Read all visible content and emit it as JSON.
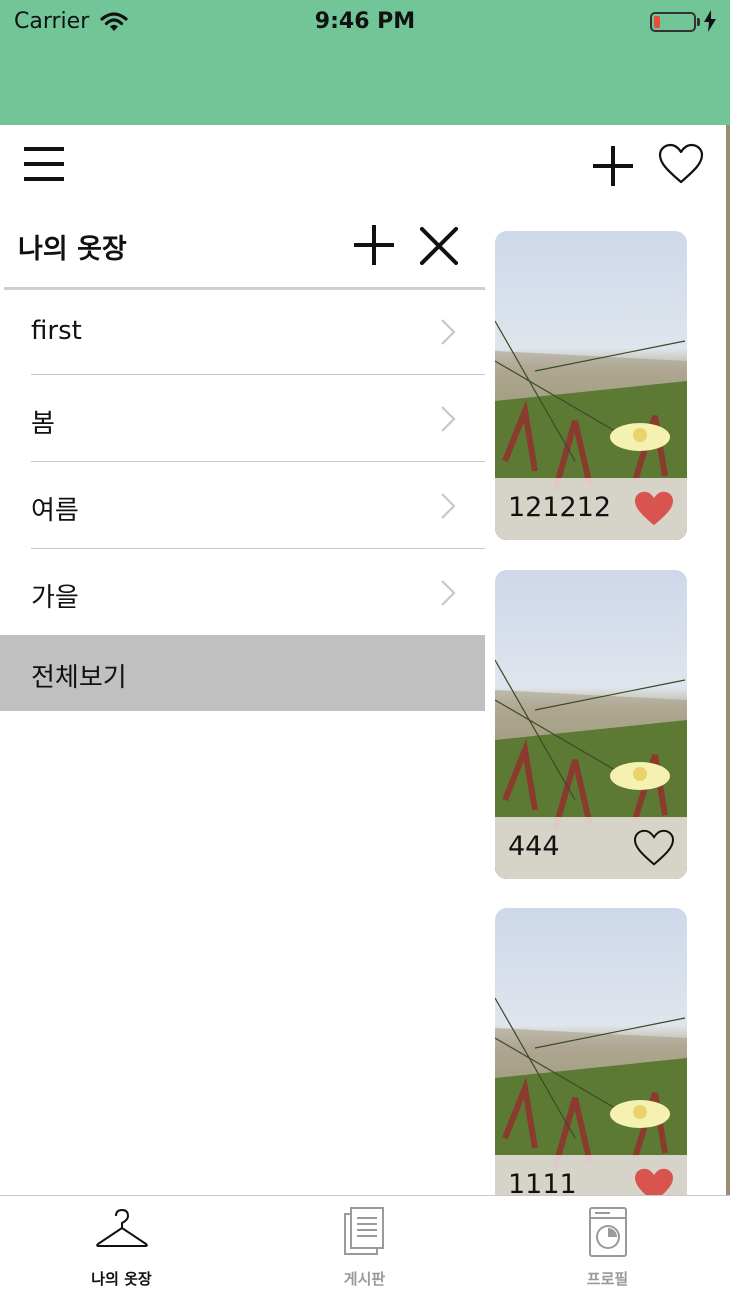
{
  "status_bar": {
    "carrier": "Carrier",
    "time": "9:46 PM",
    "background": "#71c597"
  },
  "nav_bar": {
    "left_icon": "hamburger-menu-icon",
    "right_icons": [
      "plus-icon",
      "heart-outline-icon"
    ]
  },
  "drawer": {
    "title": "나의 옷장",
    "items": [
      {
        "label": "first"
      },
      {
        "label": "봄"
      },
      {
        "label": "여름"
      },
      {
        "label": "가을"
      }
    ],
    "selected_item": {
      "label": "전체보기",
      "background": "#c0c0c0"
    }
  },
  "cards": [
    {
      "label": "121212",
      "liked": true
    },
    {
      "label": "444",
      "liked": false
    },
    {
      "label": "1111",
      "liked": true
    }
  ],
  "tab_bar": {
    "tabs": [
      {
        "label": "나의 옷장",
        "icon": "hanger-icon",
        "active": true
      },
      {
        "label": "게시판",
        "icon": "document-icon",
        "active": false
      },
      {
        "label": "프로필",
        "icon": "washing-machine-icon",
        "active": false
      }
    ],
    "active_color": "#111111",
    "inactive_color": "#9a9a9a"
  },
  "colors": {
    "liked_heart": "#d9534f"
  }
}
